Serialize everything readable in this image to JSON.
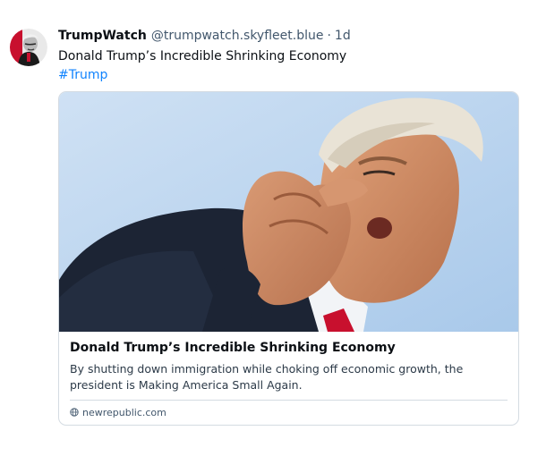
{
  "post": {
    "author": {
      "display_name": "TrumpWatch",
      "handle": "@trumpwatch.skyfleet.blue",
      "avatar_icon": "avatar-trumpwatch"
    },
    "separator": "·",
    "timestamp": "1d",
    "text": "Donald Trump’s Incredible Shrinking Economy",
    "hashtag": "#Trump",
    "link_card": {
      "image": "photo-trump-pointing",
      "title": "Donald Trump’s Incredible Shrinking Economy",
      "description": "By shutting down immigration while choking off economic growth, the president is Making America Small Again.",
      "domain": "newrepublic.com",
      "domain_icon": "globe-icon"
    }
  },
  "colors": {
    "text_primary": "#0b0f14",
    "text_secondary": "#42576c",
    "link": "#1083fe",
    "border": "#d4dbe2"
  }
}
